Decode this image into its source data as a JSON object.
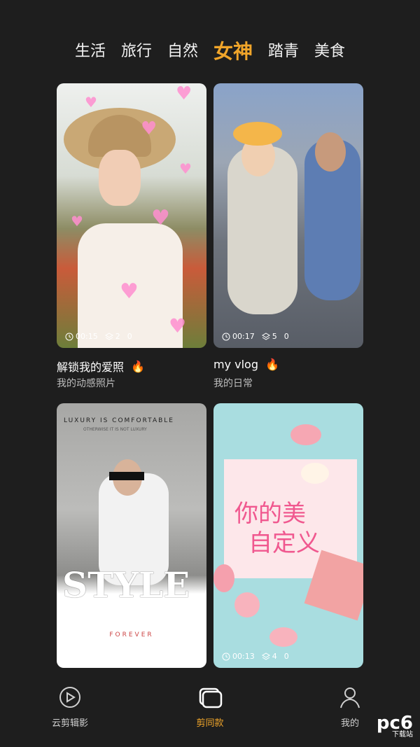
{
  "tabs": [
    "生活",
    "旅行",
    "自然",
    "女神",
    "踏青",
    "美食"
  ],
  "active_tab": "女神",
  "cards": [
    {
      "title": "解锁我的爱照",
      "subtitle": "我的动感照片",
      "duration": "00:15",
      "layers": "2",
      "count": "0"
    },
    {
      "title": "my vlog",
      "subtitle": "我的日常",
      "duration": "00:17",
      "layers": "5",
      "count": "0"
    },
    {
      "style_top": "LUXURY IS COMFORTABLE",
      "style_sub": "OTHERWISE IT IS NOT LUXURY",
      "style_word": "STYLE",
      "style_footer": "FOREVER"
    },
    {
      "overlay_line1": "你的美",
      "overlay_line2": "自定义",
      "duration": "00:13",
      "layers": "4",
      "count": "0"
    }
  ],
  "nav": [
    {
      "label": "云剪辑影",
      "icon": "play-circle-icon"
    },
    {
      "label": "剪同款",
      "icon": "layers-icon"
    },
    {
      "label": "我的",
      "icon": "user-icon"
    }
  ],
  "watermark": {
    "main": "pc6",
    "sub": "下载站"
  }
}
